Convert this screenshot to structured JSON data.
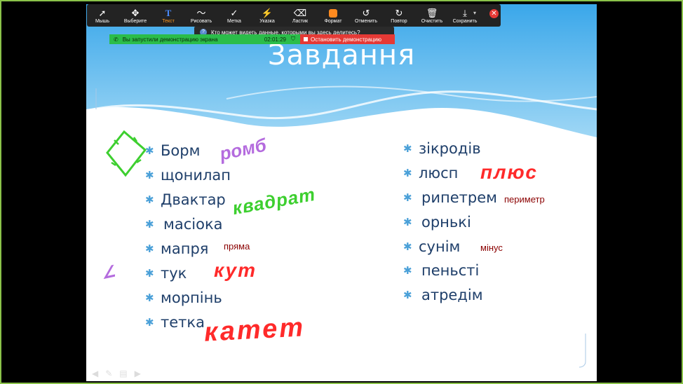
{
  "toolbar": {
    "items": [
      {
        "label": "Мышь",
        "icon": "cursor-icon"
      },
      {
        "label": "Выберите",
        "icon": "move-icon"
      },
      {
        "label": "Текст",
        "icon": "text-icon"
      },
      {
        "label": "Рисовать",
        "icon": "draw-icon"
      },
      {
        "label": "Метка",
        "icon": "stamp-icon"
      },
      {
        "label": "Указка",
        "icon": "spotlight-icon"
      },
      {
        "label": "Ластик",
        "icon": "eraser-icon"
      },
      {
        "label": "Формат",
        "icon": "format-icon"
      },
      {
        "label": "Отменить",
        "icon": "undo-icon"
      },
      {
        "label": "Повтор",
        "icon": "redo-icon"
      },
      {
        "label": "Очистить",
        "icon": "trash-icon"
      },
      {
        "label": "Сохранить",
        "icon": "save-icon"
      }
    ],
    "active_label": "Текст",
    "format_color": "#ff8a1f"
  },
  "tooltip": {
    "text": "Кто может видеть данные, которыми вы здесь делитесь?"
  },
  "share_bar": {
    "status_text": "Вы запустили демонстрацию экрана",
    "timer": "02:01:29",
    "stop_label": "Остановить демонстрацию"
  },
  "slide": {
    "title": "Завдання",
    "left_items": [
      "Борм",
      "щонилап",
      "Двактар",
      "масіока",
      "мапря",
      "тук",
      "морпінь",
      "тетка"
    ],
    "right_items": [
      "зікродів",
      "люсп",
      "рипетрем",
      "орнькі",
      "сунім",
      "пеньсті",
      "атредім"
    ]
  },
  "annotations": {
    "romb": "ромб",
    "kvadrat": "квадрат",
    "priama": "пряма",
    "kut": "кут",
    "katet": "катет",
    "plius": "плюс",
    "perymetr": "периметр",
    "minus": "мінус"
  },
  "colors": {
    "frame": "#8bc34a",
    "accent": "#4aa0d8"
  }
}
